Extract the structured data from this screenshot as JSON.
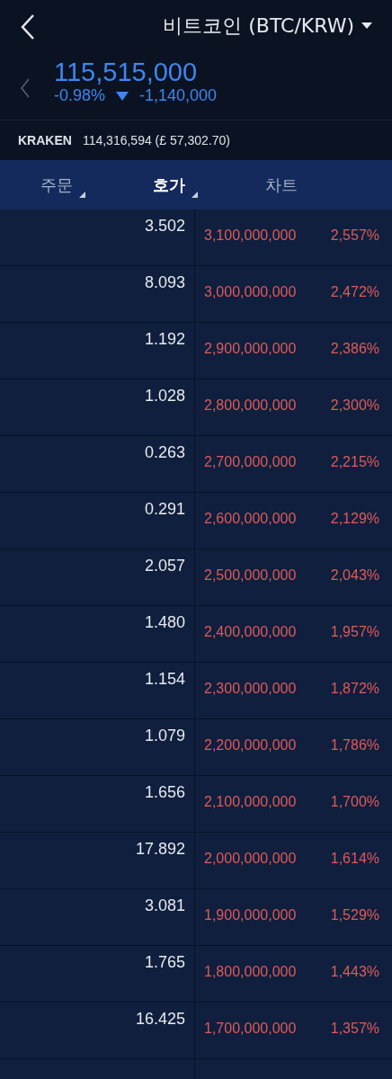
{
  "header": {
    "title": "비트코인 (BTC/KRW)",
    "price": "115,515,000",
    "change_pct": "-0.98%",
    "change_amount": "-1,140,000",
    "falling": true
  },
  "reference": {
    "exchange": "KRAKEN",
    "value": "114,316,594 (£ 57,302.70)"
  },
  "tabs": [
    {
      "label": "주문",
      "selected": false,
      "has_menu": true
    },
    {
      "label": "호가",
      "selected": true,
      "has_menu": true
    },
    {
      "label": "차트",
      "selected": false,
      "has_menu": false
    }
  ],
  "orderbook": [
    {
      "quantity": "3.502",
      "price": "3,100,000,000",
      "percent": "2,557%"
    },
    {
      "quantity": "8.093",
      "price": "3,000,000,000",
      "percent": "2,472%"
    },
    {
      "quantity": "1.192",
      "price": "2,900,000,000",
      "percent": "2,386%"
    },
    {
      "quantity": "1.028",
      "price": "2,800,000,000",
      "percent": "2,300%"
    },
    {
      "quantity": "0.263",
      "price": "2,700,000,000",
      "percent": "2,215%"
    },
    {
      "quantity": "0.291",
      "price": "2,600,000,000",
      "percent": "2,129%"
    },
    {
      "quantity": "2.057",
      "price": "2,500,000,000",
      "percent": "2,043%"
    },
    {
      "quantity": "1.480",
      "price": "2,400,000,000",
      "percent": "1,957%"
    },
    {
      "quantity": "1.154",
      "price": "2,300,000,000",
      "percent": "1,872%"
    },
    {
      "quantity": "1.079",
      "price": "2,200,000,000",
      "percent": "1,786%"
    },
    {
      "quantity": "1.656",
      "price": "2,100,000,000",
      "percent": "1,700%"
    },
    {
      "quantity": "17.892",
      "price": "2,000,000,000",
      "percent": "1,614%"
    },
    {
      "quantity": "3.081",
      "price": "1,900,000,000",
      "percent": "1,529%"
    },
    {
      "quantity": "1.765",
      "price": "1,800,000,000",
      "percent": "1,443%"
    },
    {
      "quantity": "16.425",
      "price": "1,700,000,000",
      "percent": "1,357%"
    }
  ]
}
